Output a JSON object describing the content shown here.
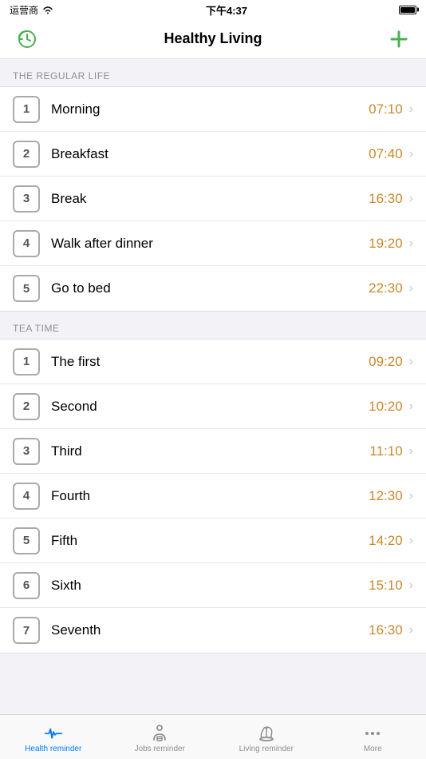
{
  "statusBar": {
    "carrier": "运营商",
    "time": "下午4:37",
    "batteryLevel": 90
  },
  "navBar": {
    "title": "Healthy Living",
    "addLabel": "+"
  },
  "sections": [
    {
      "header": "THE REGULAR LIFE",
      "items": [
        {
          "number": "1",
          "label": "Morning",
          "time": "07:10"
        },
        {
          "number": "2",
          "label": "Breakfast",
          "time": "07:40"
        },
        {
          "number": "3",
          "label": "Break",
          "time": "16:30"
        },
        {
          "number": "4",
          "label": "Walk after dinner",
          "time": "19:20"
        },
        {
          "number": "5",
          "label": "Go to bed",
          "time": "22:30"
        }
      ]
    },
    {
      "header": "TEA TIME",
      "items": [
        {
          "number": "1",
          "label": "The first",
          "time": "09:20"
        },
        {
          "number": "2",
          "label": "Second",
          "time": "10:20"
        },
        {
          "number": "3",
          "label": "Third",
          "time": "11:10"
        },
        {
          "number": "4",
          "label": "Fourth",
          "time": "12:30"
        },
        {
          "number": "5",
          "label": "Fifth",
          "time": "14:20"
        },
        {
          "number": "6",
          "label": "Sixth",
          "time": "15:10"
        },
        {
          "number": "7",
          "label": "Seventh",
          "time": "16:30"
        }
      ]
    }
  ],
  "tabBar": {
    "items": [
      {
        "id": "health-reminder",
        "label": "Health reminder",
        "active": true
      },
      {
        "id": "jobs-reminder",
        "label": "Jobs reminder",
        "active": false
      },
      {
        "id": "living-reminder",
        "label": "Living reminder",
        "active": false
      },
      {
        "id": "more",
        "label": "More",
        "active": false
      }
    ]
  }
}
